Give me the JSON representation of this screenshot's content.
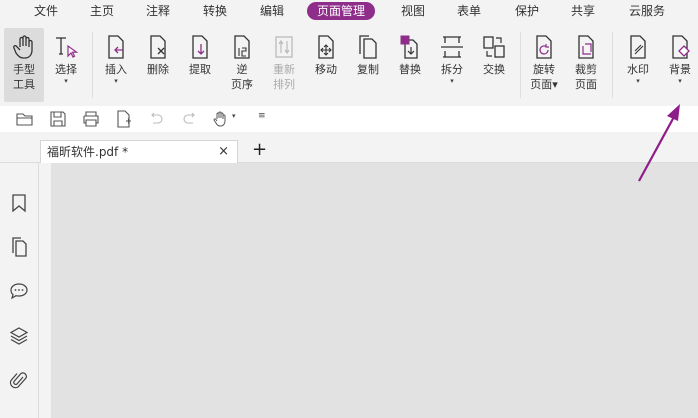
{
  "menu": {
    "items": [
      "文件",
      "主页",
      "注释",
      "转换",
      "编辑",
      "页面管理",
      "视图",
      "表单",
      "保护",
      "共享",
      "云服务"
    ],
    "active": "页面管理"
  },
  "ribbon": {
    "tools": [
      {
        "label1": "手型",
        "label2": "工具",
        "icon": "hand-icon"
      },
      {
        "label1": "选择",
        "label2": "▾",
        "icon": "select-cursor-icon"
      },
      {
        "label1": "插入",
        "label2": "▾",
        "icon": "insert-page-icon"
      },
      {
        "label1": "删除",
        "label2": "",
        "icon": "delete-page-icon"
      },
      {
        "label1": "提取",
        "label2": "",
        "icon": "extract-page-icon"
      },
      {
        "label1": "逆",
        "label2": "页序",
        "icon": "reverse-order-icon"
      },
      {
        "label1": "重新",
        "label2": "排列",
        "icon": "rearrange-icon"
      },
      {
        "label1": "移动",
        "label2": "",
        "icon": "move-page-icon"
      },
      {
        "label1": "复制",
        "label2": "",
        "icon": "copy-page-icon"
      },
      {
        "label1": "替换",
        "label2": "",
        "icon": "replace-page-icon"
      },
      {
        "label1": "拆分",
        "label2": "▾",
        "icon": "split-icon"
      },
      {
        "label1": "交换",
        "label2": "",
        "icon": "swap-icon"
      },
      {
        "label1": "旋转",
        "label2": "页面▾",
        "icon": "rotate-page-icon"
      },
      {
        "label1": "裁剪",
        "label2": "页面",
        "icon": "crop-page-icon"
      },
      {
        "label1": "水印",
        "label2": "▾",
        "icon": "watermark-icon"
      },
      {
        "label1": "背景",
        "label2": "▾",
        "icon": "background-icon"
      }
    ]
  },
  "tabs": {
    "document": "福昕软件.pdf *",
    "close": "×",
    "new": "+"
  },
  "colors": {
    "accent": "#8e2d8a",
    "chrome": "#f3f3f3",
    "canvas": "#e2e2e2"
  }
}
